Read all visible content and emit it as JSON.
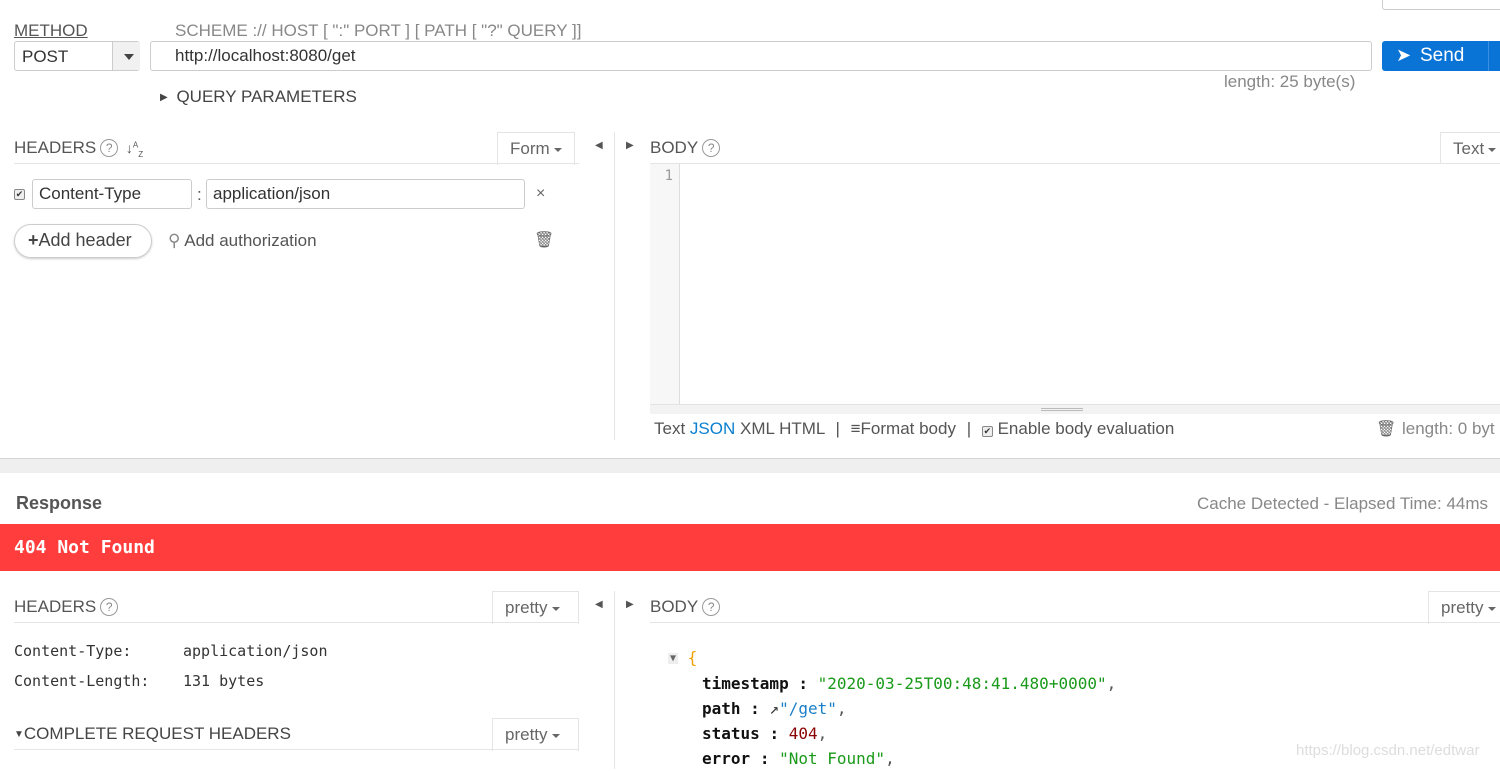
{
  "request": {
    "method_label": "METHOD",
    "method_value": "POST",
    "url_hint": "SCHEME :// HOST [ \":\" PORT ] [ PATH [ \"?\" QUERY ]]",
    "url_value": "http://localhost:8080/get",
    "url_length": "length: 25 byte(s)",
    "send_label": "Send",
    "query_params_label": "QUERY PARAMETERS",
    "headers": {
      "title": "HEADERS",
      "mode": "Form",
      "rows": [
        {
          "enabled": true,
          "name": "Content-Type",
          "value": "application/json"
        }
      ],
      "add_header": "Add header",
      "add_authorization": "Add authorization"
    },
    "body": {
      "title": "BODY",
      "mode": "Text",
      "line_number": "1",
      "formats": [
        "Text",
        "JSON",
        "XML",
        "HTML"
      ],
      "active_format": "JSON",
      "separator": "|",
      "format_body": "Format body",
      "enable_eval": "Enable body evaluation",
      "length": "length: 0 byt"
    }
  },
  "response": {
    "title": "Response",
    "cache_info": "Cache Detected - Elapsed Time: 44ms",
    "status": "404 Not Found",
    "status_color": "#ff3d3d",
    "accent_color": "#0a74d6",
    "headers": {
      "title": "HEADERS",
      "mode": "pretty",
      "rows": [
        {
          "name": "Content-Type:",
          "value": "application/json"
        },
        {
          "name": "Content-Length:",
          "value": "131 bytes"
        }
      ],
      "complete_request_headers": "COMPLETE REQUEST HEADERS",
      "complete_mode": "pretty"
    },
    "body": {
      "title": "BODY",
      "mode": "pretty",
      "open_brace": "{",
      "fields": [
        {
          "key": "timestamp",
          "value": "\"2020-03-25T00:48:41.480+0000\"",
          "type": "string"
        },
        {
          "key": "path",
          "value": "\"/get\"",
          "type": "link"
        },
        {
          "key": "status",
          "value": "404",
          "type": "number"
        },
        {
          "key": "error",
          "value": "\"Not Found\"",
          "type": "string"
        }
      ]
    }
  },
  "watermark": "https://blog.csdn.net/edtwar"
}
